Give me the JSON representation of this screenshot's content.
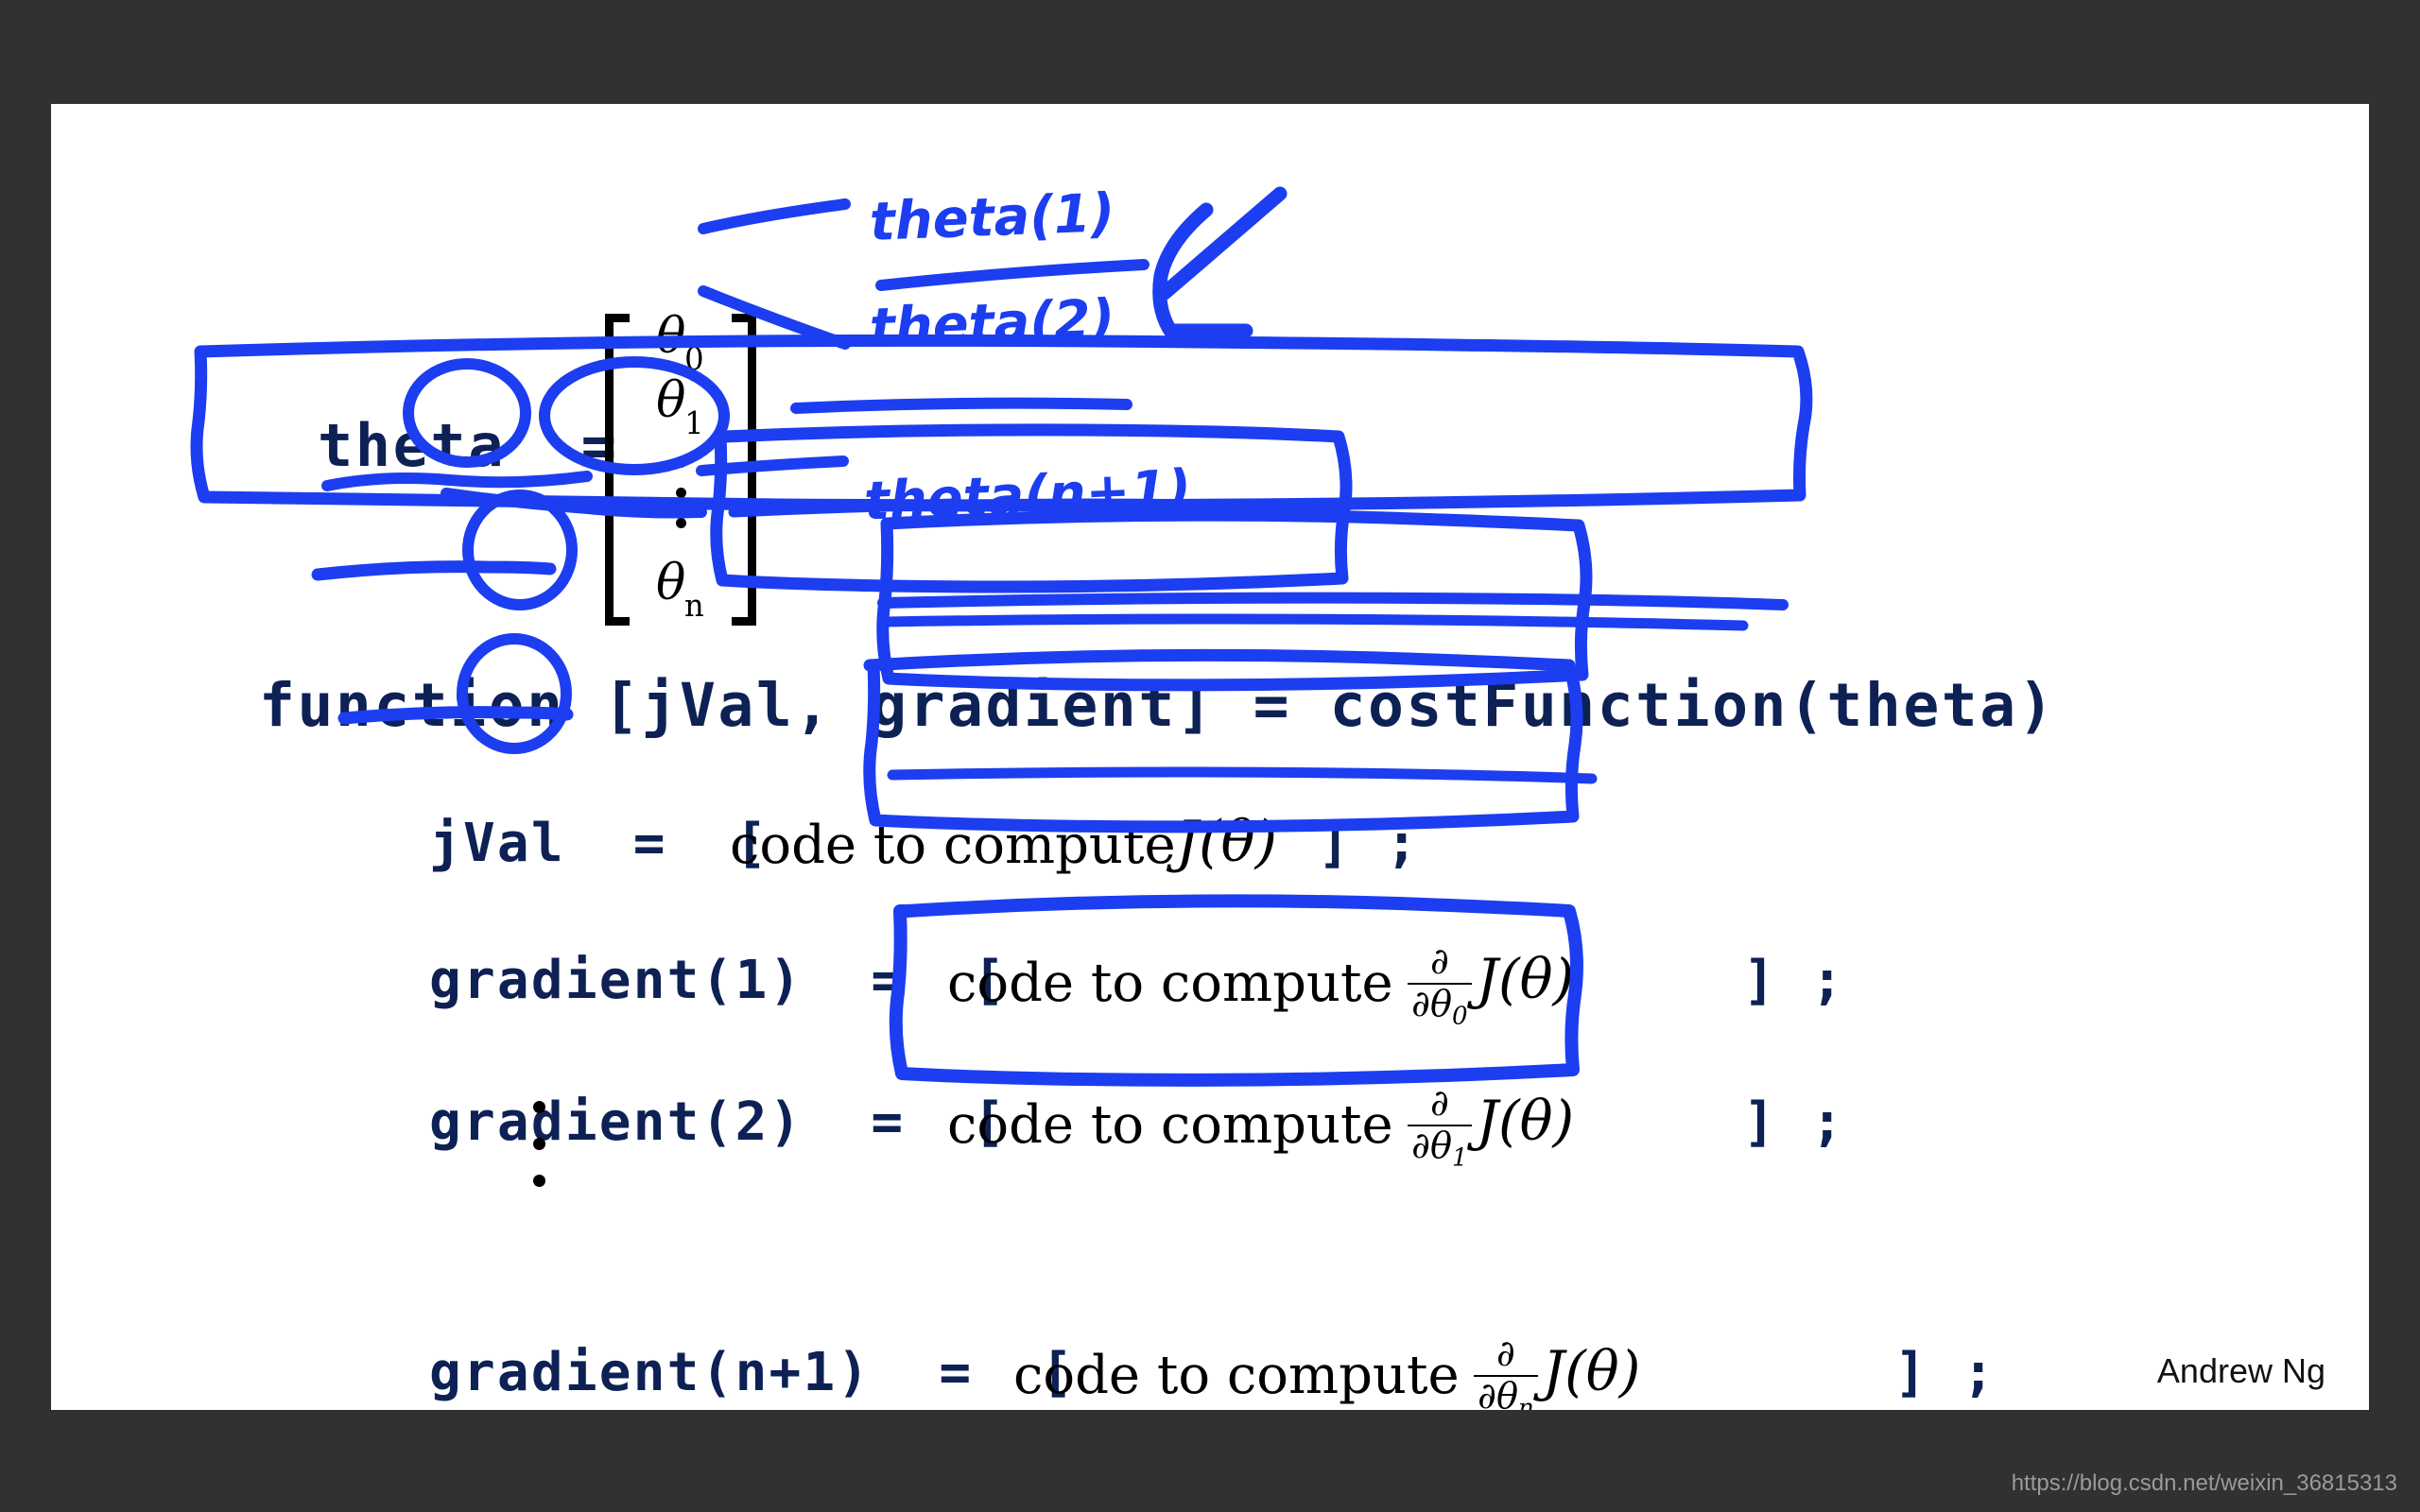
{
  "slide": {
    "author": "Andrew Ng",
    "watermark": "https://blog.csdn.net/weixin_36815313",
    "background_color": "#313131",
    "slide_color": "#ffffff",
    "code_color": "#0d2155",
    "ink_color": "#1c3ef0",
    "math_color": "#000000"
  },
  "theta_definition": {
    "label": "theta  =",
    "matrix_entries": [
      "θ0",
      "θ1",
      "⋮",
      "θn"
    ],
    "row0": {
      "sym": "θ",
      "sub": "0"
    },
    "row1": {
      "sym": "θ",
      "sub": "1"
    },
    "rown": {
      "sym": "θ",
      "sub": "n"
    }
  },
  "annotations": {
    "theta_1": "theta(1)",
    "theta_2": "theta(2)",
    "theta_n1": "theta(n+1)",
    "arrow": "left-arrow"
  },
  "code": {
    "signature": "function [jVal, gradient] = costFunction(theta)",
    "lines": [
      {
        "lhs": "jVal  =  [",
        "prose": "code to compute",
        "math_kind": "J",
        "partial_sub": "",
        "rhs": "] ;"
      },
      {
        "lhs": "gradient(1)  =  [",
        "prose": "code to compute",
        "math_kind": "partial",
        "partial_sub": "0",
        "rhs": "] ;"
      },
      {
        "lhs": "gradient(2)  =  [",
        "prose": "code to compute",
        "math_kind": "partial",
        "partial_sub": "1",
        "rhs": "] ;"
      },
      {
        "lhs": "gradient(n+1)  =  [",
        "prose": "code to compute",
        "math_kind": "partial",
        "partial_sub": "n",
        "rhs": "] ;"
      }
    ],
    "vertical_ellipsis": "⋮",
    "math_J": "J(θ)",
    "partial_numerator": "∂",
    "partial_denominator_prefix": "∂θ"
  }
}
